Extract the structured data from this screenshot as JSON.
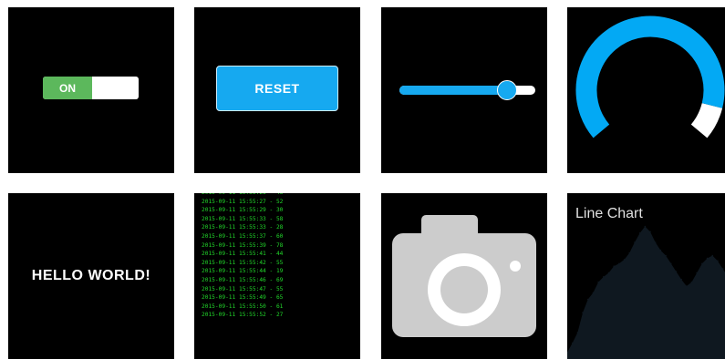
{
  "toggle": {
    "label": "ON",
    "state": "on",
    "color": "#5cb85c"
  },
  "reset_button": {
    "label": "RESET",
    "color": "#16a9f0"
  },
  "slider": {
    "value": 0.79,
    "color": "#16a9f0"
  },
  "gauge": {
    "value": 0.9,
    "color": "#03a9f4",
    "remainder_color": "#ffffff"
  },
  "hello": {
    "text": "HELLO WORLD!"
  },
  "log": {
    "lines": [
      "2015-09-11 15:55:26 - 46",
      "2015-09-11 15:55:27 - 52",
      "2015-09-11 15:55:29 - 30",
      "2015-09-11 15:55:33 - 58",
      "2015-09-11 15:55:33 - 28",
      "2015-09-11 15:55:37 - 60",
      "2015-09-11 15:55:39 - 78",
      "2015-09-11 15:55:41 - 44",
      "2015-09-11 15:55:42 - 55",
      "2015-09-11 15:55:44 - 19",
      "2015-09-11 15:55:46 - 69",
      "2015-09-11 15:55:47 - 55",
      "2015-09-11 15:55:49 - 65",
      "2015-09-11 15:55:50 - 61",
      "2015-09-11 15:55:52 - 27"
    ],
    "color": "#21d62a"
  },
  "camera": {
    "icon": "camera-icon",
    "color": "#cccccc"
  },
  "chart_data": {
    "type": "area",
    "title": "Line Chart",
    "values": [
      5,
      12,
      20,
      35,
      45,
      50,
      58,
      62,
      65,
      70,
      72,
      75,
      80,
      88,
      95,
      100,
      96,
      88,
      82,
      78,
      72,
      66,
      60,
      55,
      58,
      65,
      72,
      76,
      78,
      74,
      68,
      62,
      55
    ],
    "ylim": [
      0,
      110
    ],
    "color": "#0f1820"
  }
}
